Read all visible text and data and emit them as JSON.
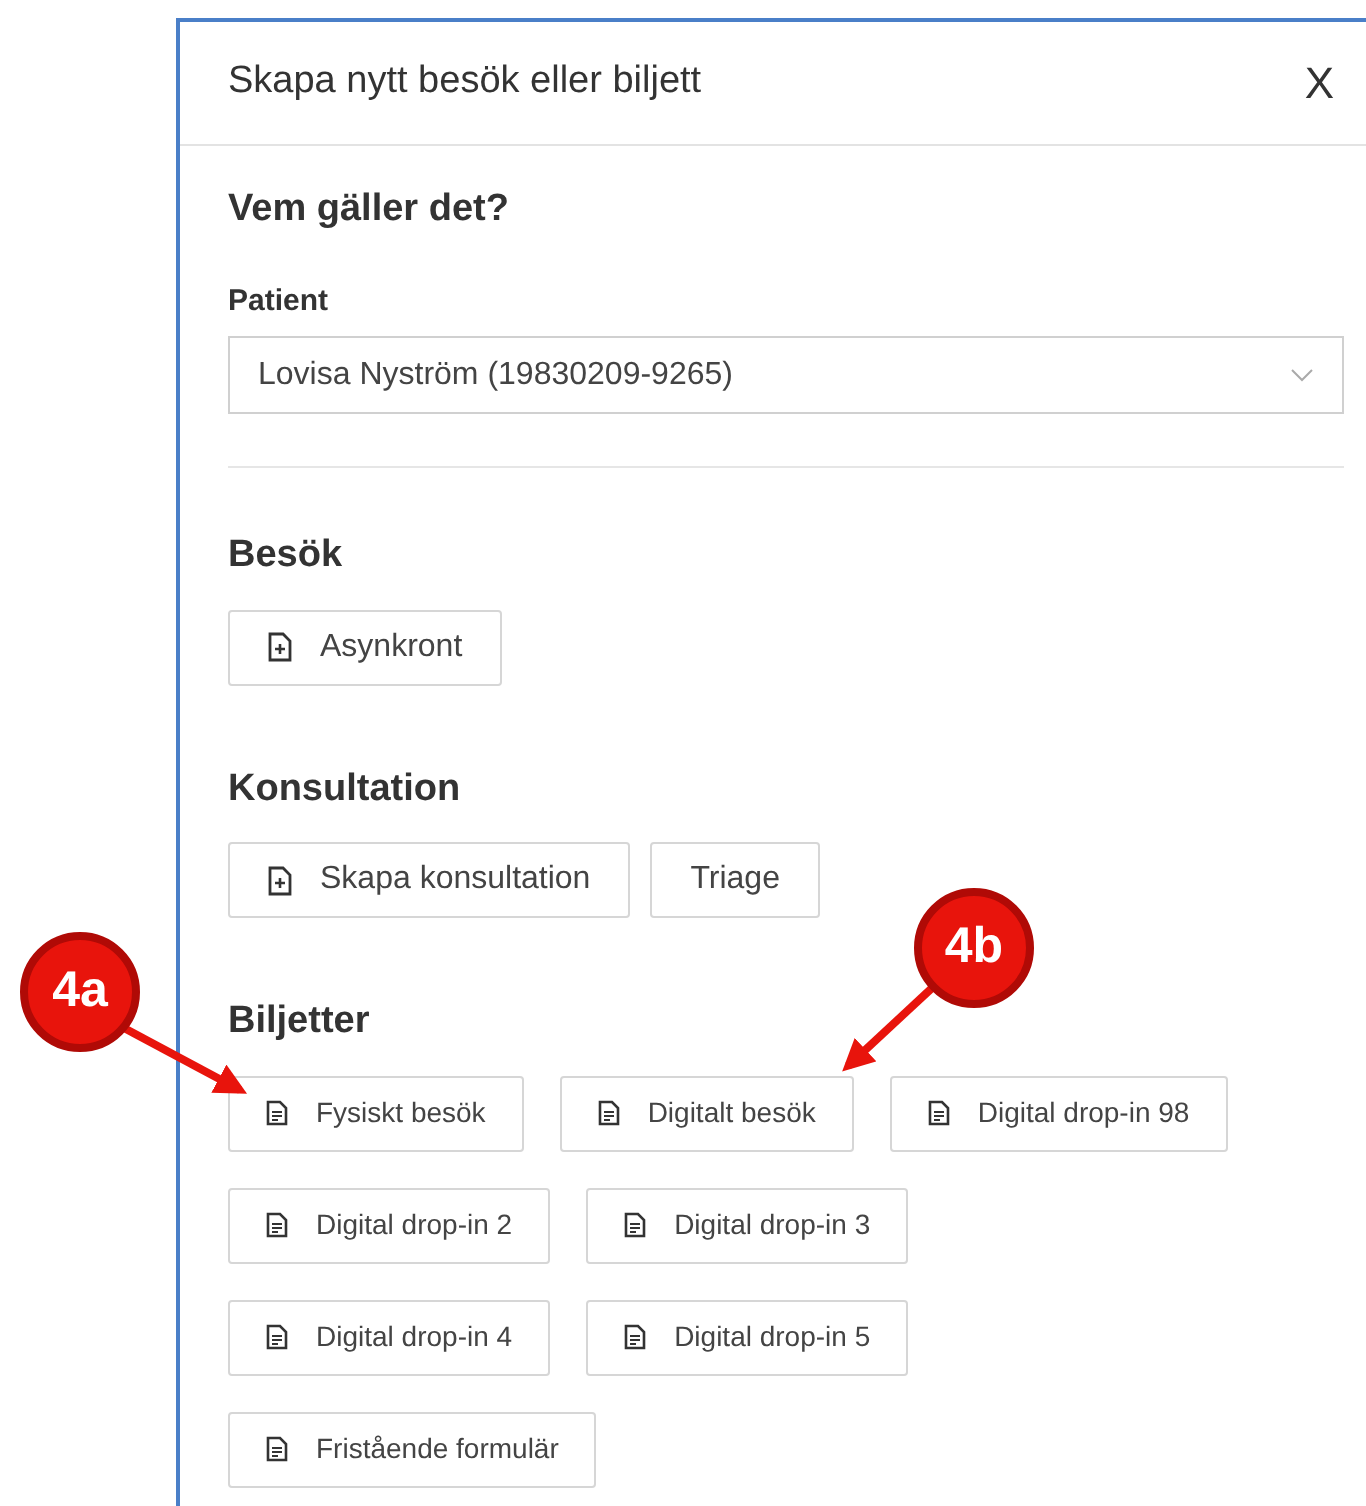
{
  "dialog": {
    "title": "Skapa nytt besök eller biljett",
    "close": "X"
  },
  "who": {
    "heading": "Vem gäller det?",
    "patient_label": "Patient",
    "patient_value": "Lovisa Nyström (19830209-9265)"
  },
  "sections": [
    {
      "heading": "Besök",
      "buttons": [
        {
          "label": "Asynkront",
          "kind": "add"
        }
      ]
    },
    {
      "heading": "Konsultation",
      "buttons": [
        {
          "label": "Skapa konsultation",
          "kind": "add"
        },
        {
          "label": "Triage",
          "kind": "plain"
        }
      ]
    },
    {
      "heading": "Biljetter",
      "buttons": [
        {
          "label": "Fysiskt besök",
          "kind": "ticket"
        },
        {
          "label": "Digitalt besök",
          "kind": "ticket"
        },
        {
          "label": "Digital drop-in 98",
          "kind": "ticket"
        },
        {
          "label": "Digital drop-in 2",
          "kind": "ticket"
        },
        {
          "label": "Digital drop-in 3",
          "kind": "ticket"
        },
        {
          "label": "Digital drop-in 4",
          "kind": "ticket"
        },
        {
          "label": "Digital drop-in 5",
          "kind": "ticket"
        },
        {
          "label": "Fristående formulär",
          "kind": "ticket"
        }
      ]
    }
  ],
  "annotations": [
    {
      "label": "4a"
    },
    {
      "label": "4b"
    }
  ]
}
